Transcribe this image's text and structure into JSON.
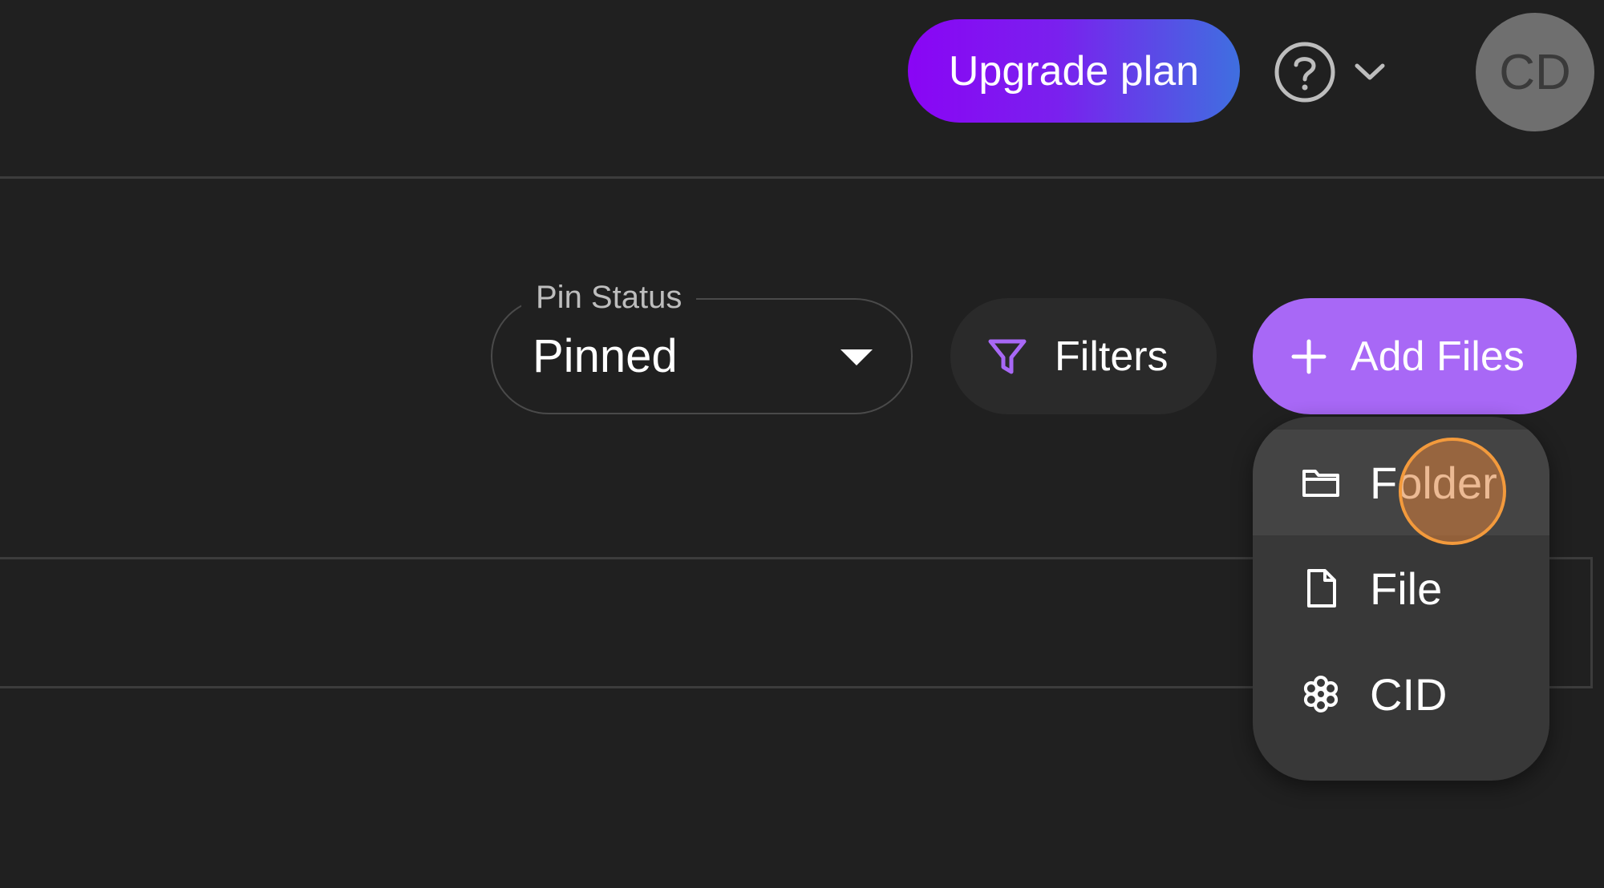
{
  "header": {
    "upgrade_label": "Upgrade plan",
    "help_icon": "help-circle-icon",
    "help_chevron_icon": "chevron-down-icon",
    "avatar_initials": "CD"
  },
  "toolbar": {
    "pin_status": {
      "label": "Pin Status",
      "value": "Pinned",
      "icon": "caret-down-icon"
    },
    "filters": {
      "label": "Filters",
      "icon": "filter-icon"
    },
    "add_files": {
      "label": "Add Files",
      "icon": "plus-icon"
    }
  },
  "add_menu": {
    "items": [
      {
        "label": "Folder",
        "icon": "folder-icon"
      },
      {
        "label": "File",
        "icon": "file-icon"
      },
      {
        "label": "CID",
        "icon": "cid-icon"
      }
    ]
  },
  "colors": {
    "background": "#202020",
    "accent_purple": "#a868f6",
    "upgrade_gradient_start": "#8a05f5",
    "upgrade_gradient_end": "#3f6fe0",
    "filter_icon": "#a868f6",
    "cursor_highlight": "#f39a3c"
  }
}
